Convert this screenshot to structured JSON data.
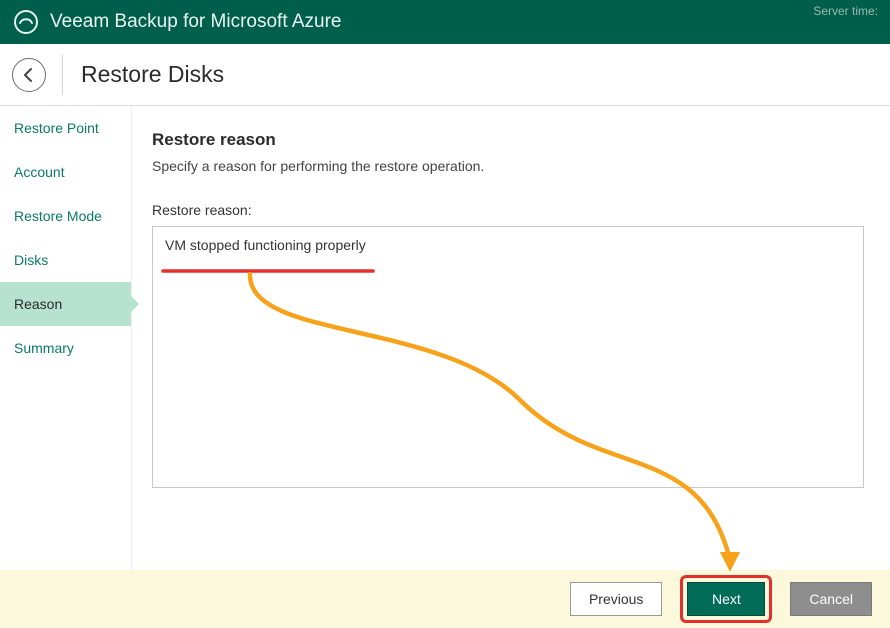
{
  "topbar": {
    "title": "Veeam Backup for Microsoft Azure",
    "server_time_label": "Server time:"
  },
  "subheader": {
    "title": "Restore Disks"
  },
  "sidebar": {
    "items": [
      {
        "label": "Restore Point",
        "active": false
      },
      {
        "label": "Account",
        "active": false
      },
      {
        "label": "Restore Mode",
        "active": false
      },
      {
        "label": "Disks",
        "active": false
      },
      {
        "label": "Reason",
        "active": true
      },
      {
        "label": "Summary",
        "active": false
      }
    ]
  },
  "content": {
    "heading": "Restore reason",
    "description": "Specify a reason for performing the restore operation.",
    "field_label": "Restore reason:",
    "field_value": "VM stopped functioning properly"
  },
  "footer": {
    "previous_label": "Previous",
    "next_label": "Next",
    "cancel_label": "Cancel"
  },
  "annotation": {
    "underline_color": "#e4302b",
    "arrow_color": "#f6a21b"
  }
}
